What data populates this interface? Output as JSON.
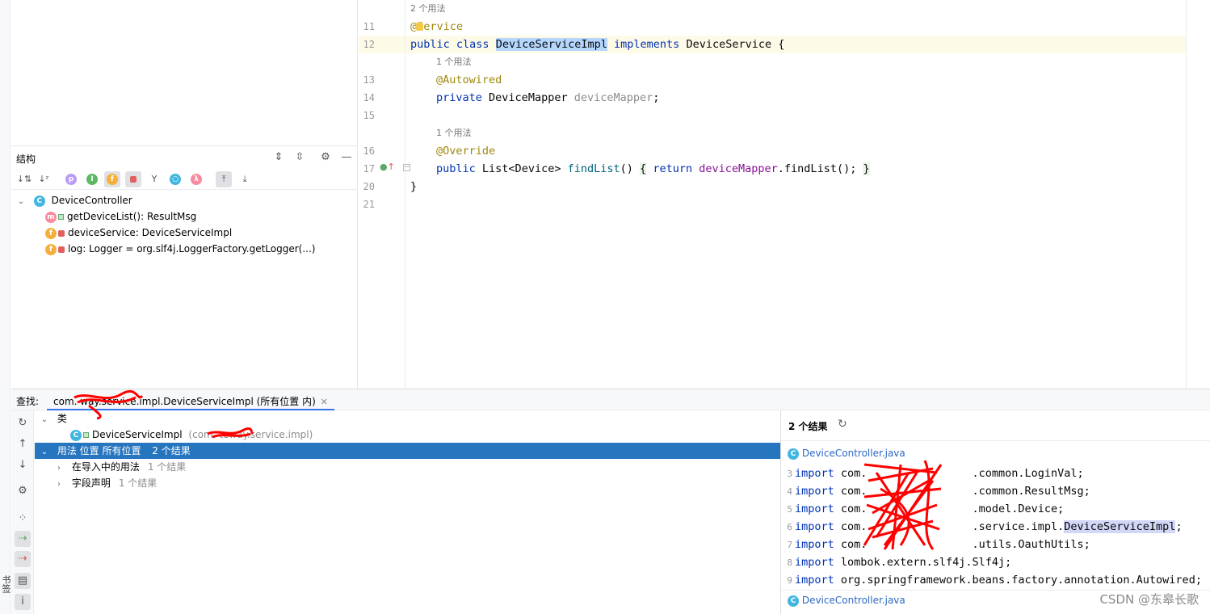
{
  "sidebar": {
    "bookmarks_label": "书签"
  },
  "structure": {
    "title": "结构",
    "toolbar_icons": [
      "sort-by-visibility-icon",
      "sort-alpha-icon",
      "show-properties-icon",
      "show-inherited-icon",
      "show-fields-icon",
      "show-non-public-icon",
      "show-hierarchy-icon",
      "show-anonymous-icon",
      "show-lambdas-icon",
      "autoscroll-to-source-icon",
      "autoscroll-from-source-icon"
    ],
    "root": {
      "name": "DeviceController",
      "icon": "C"
    },
    "members": [
      {
        "icon": "m",
        "text": "getDeviceList(): ResultMsg"
      },
      {
        "icon": "f",
        "text": "deviceService: DeviceServiceImpl"
      },
      {
        "icon": "f",
        "text": "log: Logger = org.slf4j.LoggerFactory.getLogger(...)"
      }
    ]
  },
  "editor": {
    "lines": [
      {
        "hint": "2 个用法"
      },
      {
        "num": "11",
        "annotation": "@Service"
      },
      {
        "num": "12",
        "kw1": "public",
        "kw2": "class",
        "class_name": "DeviceServiceImpl",
        "kw3": "implements",
        "iface": "DeviceService",
        "brace": "{"
      },
      {
        "hint": "1 个用法"
      },
      {
        "num": "13",
        "annotation": "@Autowired"
      },
      {
        "num": "14",
        "kw": "private",
        "type": "DeviceMapper",
        "field": "deviceMapper",
        "end": ";"
      },
      {
        "num": "15"
      },
      {
        "hint": "1 个用法"
      },
      {
        "num": "16",
        "annotation": "@Override"
      },
      {
        "num": "17",
        "kw": "public",
        "ret": "List<Device>",
        "method": "findList",
        "parens": "()",
        "ob": "{",
        "ret_kw": "return",
        "field": "deviceMapper",
        "call": ".findList();",
        "cb": "}"
      },
      {
        "num": "20",
        "brace": "}"
      },
      {
        "num": "21"
      }
    ]
  },
  "find": {
    "label": "查找:",
    "tab_title": "com.         way.service.impl.DeviceServiceImpl (所有位置 内)",
    "close": "✕",
    "tree": {
      "class_group": "类",
      "class_item": "DeviceServiceImpl",
      "class_pkg": "(com.         teway.service.impl)",
      "usages_group": "用法 位置 所有位置",
      "usages_count": "2 个结果",
      "children": [
        {
          "label": "在导入中的用法",
          "count": "1 个结果"
        },
        {
          "label": "字段声明",
          "count": "1 个结果"
        }
      ]
    },
    "preview": {
      "count": "2 个结果",
      "file1": "DeviceController.java",
      "file2": "DeviceController.java",
      "lines": [
        {
          "n": "3",
          "kw": "import",
          "text": "com.                .common.LoginVal;"
        },
        {
          "n": "4",
          "kw": "import",
          "text": "com.                .common.ResultMsg;"
        },
        {
          "n": "5",
          "kw": "import",
          "text": "com.                .model.Device;"
        },
        {
          "n": "6",
          "kw": "import",
          "pre": "com.                .service.impl.",
          "hl": "DeviceServiceImpl",
          "post": ";"
        },
        {
          "n": "7",
          "kw": "import",
          "text": "com.                .utils.OauthUtils;"
        },
        {
          "n": "8",
          "kw": "import",
          "text": "lombok.extern.slf4j.Slf4j;"
        },
        {
          "n": "9",
          "kw": "import",
          "text": "org.springframework.beans.factory.annotation.Autowired;"
        }
      ]
    }
  },
  "watermark": "CSDN @东皋长歌",
  "colors": {
    "accent": "#2675bf",
    "keyword": "#0033b3",
    "annotation": "#9e880d",
    "field": "#871094",
    "redaction": "#ff0000"
  }
}
